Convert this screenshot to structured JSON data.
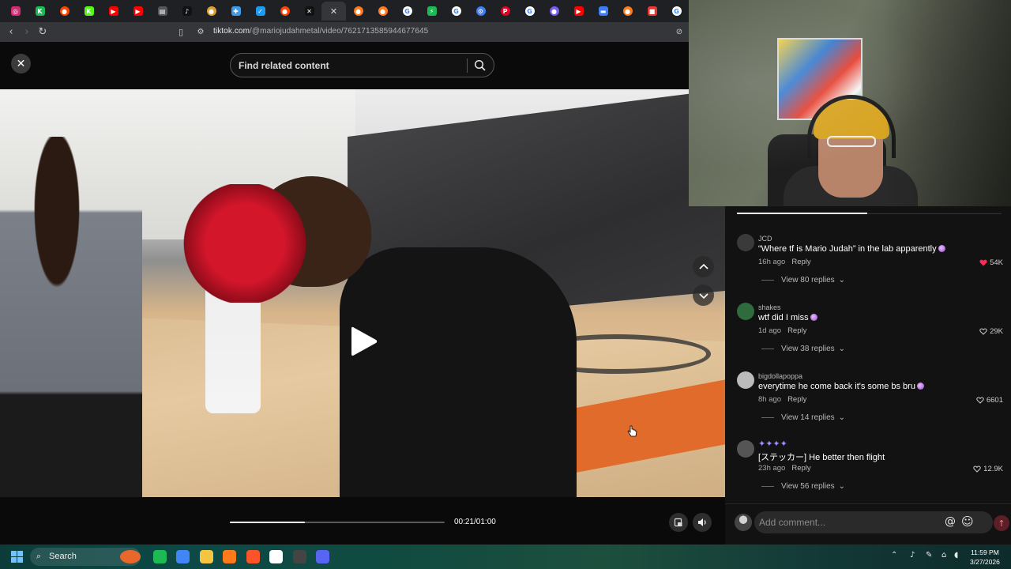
{
  "browser": {
    "url_host": "tiktok.com",
    "url_path": "/@mariojudahmetal/video/7621713585944677645",
    "tabs": [
      {
        "icon": "instagram-icon",
        "color": "#d62976",
        "glyph": "◎",
        "round": false
      },
      {
        "icon": "kick-icon",
        "color": "#1db954",
        "glyph": "K",
        "round": false
      },
      {
        "icon": "reddit-icon",
        "color": "#ff4500",
        "glyph": "●",
        "round": true
      },
      {
        "icon": "kick-icon",
        "color": "#53fc18",
        "glyph": "K",
        "round": false
      },
      {
        "icon": "youtube-icon",
        "color": "#ff0000",
        "glyph": "▶",
        "round": false
      },
      {
        "icon": "youtube-icon",
        "color": "#ff0000",
        "glyph": "▶",
        "round": false
      },
      {
        "icon": "notion-icon",
        "color": "#555555",
        "glyph": "▤",
        "round": false
      },
      {
        "icon": "tiktok-icon",
        "color": "#111111",
        "glyph": "♪",
        "round": false
      },
      {
        "icon": "cat-icon",
        "color": "#e0a030",
        "glyph": "●",
        "round": true
      },
      {
        "icon": "puzzle-icon",
        "color": "#3d9be9",
        "glyph": "✚",
        "round": false
      },
      {
        "icon": "checkmark-icon",
        "color": "#1d9bf0",
        "glyph": "✓",
        "round": false
      },
      {
        "icon": "reddit-icon",
        "color": "#ff4500",
        "glyph": "●",
        "round": true
      },
      {
        "icon": "x-icon",
        "color": "#111111",
        "glyph": "✕",
        "round": false
      },
      {
        "icon": "close-tab-icon",
        "color": "#35363a",
        "glyph": "✕",
        "round": false,
        "active": true
      },
      {
        "icon": "orange-circle-icon",
        "color": "#ff7a1a",
        "glyph": "●",
        "round": true
      },
      {
        "icon": "orange-circle-icon",
        "color": "#ff7a1a",
        "glyph": "●",
        "round": true
      },
      {
        "icon": "google-icon",
        "color": "#ffffff",
        "glyph": "G",
        "round": true
      },
      {
        "icon": "bolt-icon",
        "color": "#1db954",
        "glyph": "⚡",
        "round": false
      },
      {
        "icon": "google-icon",
        "color": "#ffffff",
        "glyph": "G",
        "round": true
      },
      {
        "icon": "gear-icon",
        "color": "#3d7ef6",
        "glyph": "⚙",
        "round": true
      },
      {
        "icon": "pinterest-icon",
        "color": "#e60023",
        "glyph": "P",
        "round": true
      },
      {
        "icon": "google-icon",
        "color": "#ffffff",
        "glyph": "G",
        "round": true
      },
      {
        "icon": "chat-icon",
        "color": "#7a5cf0",
        "glyph": "●",
        "round": true
      },
      {
        "icon": "youtube-icon",
        "color": "#ff0000",
        "glyph": "▶",
        "round": false
      },
      {
        "icon": "folder-icon",
        "color": "#3d7ef6",
        "glyph": "▬",
        "round": false
      },
      {
        "icon": "orange-circle-icon",
        "color": "#ff7a1a",
        "glyph": "●",
        "round": true
      },
      {
        "icon": "red-app-icon",
        "color": "#e53935",
        "glyph": "■",
        "round": false
      },
      {
        "icon": "google-icon",
        "color": "#ffffff",
        "glyph": "G",
        "round": true
      }
    ]
  },
  "viewer": {
    "search_placeholder": "Find related content",
    "timer": "00:21/01:00",
    "progress_fraction": 0.35
  },
  "comments": [
    {
      "user": "JCD",
      "text": "“Where tf is Mario Judah” in the lab apparently",
      "time": "16h ago",
      "reply": "Reply",
      "likes": "54K",
      "liked": true,
      "replies": "View 80 replies",
      "avatar": "#3a3a3a"
    },
    {
      "user": "shakes",
      "text": "wtf did I miss",
      "time": "1d ago",
      "reply": "Reply",
      "likes": "29K",
      "liked": false,
      "replies": "View 38 replies",
      "avatar": "#2f6b3c"
    },
    {
      "user": "bigdollapoppa",
      "text": "everytime he come back it's some bs bru",
      "time": "8h ago",
      "reply": "Reply",
      "likes": "6601",
      "liked": false,
      "replies": "View 14 replies",
      "avatar": "#bbbbbb"
    },
    {
      "user": "✦✦✦✦",
      "text": "[ステッカー] He better then flight",
      "time": "23h ago",
      "reply": "Reply",
      "likes": "12.9K",
      "liked": false,
      "replies": "View 56 replies",
      "avatar": "#555555"
    }
  ],
  "add_comment": {
    "placeholder": "Add comment..."
  },
  "taskbar": {
    "search_label": "Search",
    "time": "11:59 PM",
    "date": "3/27/2026",
    "apps": [
      {
        "name": "taskbar-app-game",
        "color": "#e8682c"
      },
      {
        "name": "taskbar-app-spotify",
        "color": "#1db954"
      },
      {
        "name": "taskbar-app-chrome",
        "color": "#4285f4"
      },
      {
        "name": "taskbar-app-files",
        "color": "#f5c542"
      },
      {
        "name": "taskbar-app-orange",
        "color": "#ff7a1a"
      },
      {
        "name": "taskbar-app-brave",
        "color": "#fb542b"
      },
      {
        "name": "taskbar-app-capcut",
        "color": "#ffffff"
      },
      {
        "name": "taskbar-app-obs",
        "color": "#444444"
      },
      {
        "name": "taskbar-app-discord",
        "color": "#5865f2"
      }
    ]
  }
}
